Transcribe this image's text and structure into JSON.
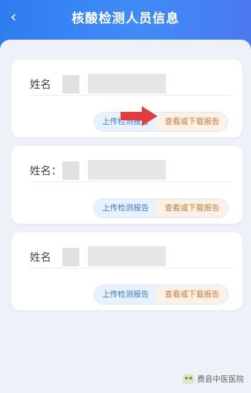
{
  "header": {
    "title": "核酸检测人员信息",
    "back_icon": "chevron-left-icon"
  },
  "records": [
    {
      "name_label": "姓名",
      "upload_label": "上传检测报告",
      "view_label": "查看或下载报告"
    },
    {
      "name_label": "姓名：",
      "upload_label": "上传检测报告",
      "view_label": "查看或下载报告"
    },
    {
      "name_label": "姓名",
      "upload_label": "上传检测报告",
      "view_label": "查看或下载报告"
    }
  ],
  "colors": {
    "header": "#2f7cf0",
    "upload": "#3d78d6",
    "view": "#c77b3e"
  },
  "watermark": {
    "text": "费县中医医院",
    "icon": "wechat-icon"
  }
}
